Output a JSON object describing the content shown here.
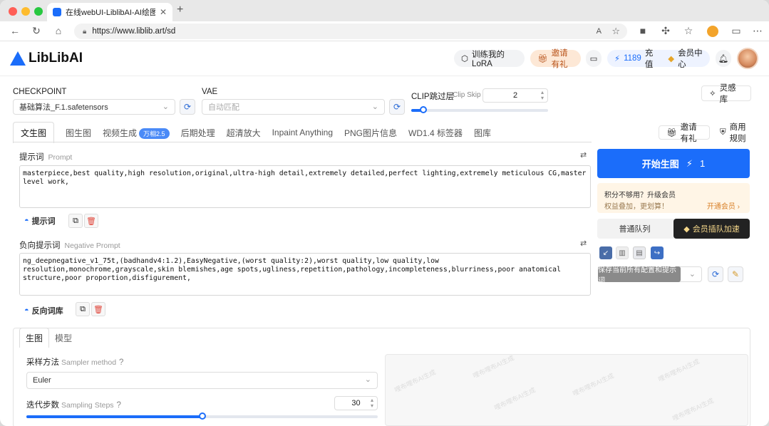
{
  "browser": {
    "tab_title": "在线webUI-LiblibAI-AI绘图工具",
    "url": "https://www.liblib.art/sd"
  },
  "header": {
    "logo_text": "LibLibAI",
    "train_lora": "训练我的LoRA",
    "invite": "邀请有礼",
    "points": "1189",
    "recharge": "充值",
    "vip_center": "会员中心"
  },
  "settings": {
    "checkpoint_label": "CHECKPOINT",
    "checkpoint_value": "基础算法_F.1.safetensors",
    "vae_label": "VAE",
    "vae_value": "自动匹配",
    "clip_label": "CLIP跳过层",
    "clip_label_en": "Clip Skip",
    "clip_value": "2",
    "clip_slider_fraction": 0.09,
    "inspiration": "灵感库"
  },
  "tabs": [
    {
      "label": "文生图"
    },
    {
      "label": "图生图"
    },
    {
      "label": "视频生成",
      "badge": "万相2.5"
    },
    {
      "label": "后期处理"
    },
    {
      "label": "超清放大"
    },
    {
      "label": "Inpaint Anything"
    },
    {
      "label": "PNG图片信息"
    },
    {
      "label": "WD1.4 标签器"
    },
    {
      "label": "图库"
    }
  ],
  "tab_right": {
    "invite": "邀请有礼",
    "rules": "商用规则"
  },
  "prompt": {
    "label": "提示词",
    "label_en": "Prompt",
    "text": "masterpiece,best quality,high resolution,original,ultra-high detail,extremely detailed,perfect lighting,extremely meticulous CG,master level work,",
    "tool_label": "提示词"
  },
  "negative": {
    "label": "负向提示词",
    "label_en": "Negative Prompt",
    "text": "ng_deepnegative_v1_75t,(badhandv4:1.2),EasyNegative,(worst quality:2),worst quality,low quality,low resolution,monochrome,grayscale,skin blemishes,age spots,ugliness,repetition,pathology,incompleteness,blurriness,poor anatomical structure,poor proportion,disfigurement,",
    "tool_label": "反向词库"
  },
  "generate": {
    "label": "开始生图",
    "cost": "1"
  },
  "promo": {
    "line1": "积分不够用？升级会员",
    "line2": "权益叠加，更划算！",
    "link": "开通会员 ›"
  },
  "queue": {
    "normal": "普通队列",
    "vip": "会员插队加速"
  },
  "tooltip": "保存当前所有配置和提示词",
  "bottom": {
    "subtab_generate": "生图",
    "subtab_model": "模型",
    "sampler_label": "采样方法",
    "sampler_label_en": "Sampler method",
    "sampler_value": "Euler",
    "steps_label": "迭代步数",
    "steps_label_en": "Sampling Steps",
    "steps_value": "30",
    "steps_fraction": 0.5
  },
  "watermark": "哩布哩布AI生成"
}
